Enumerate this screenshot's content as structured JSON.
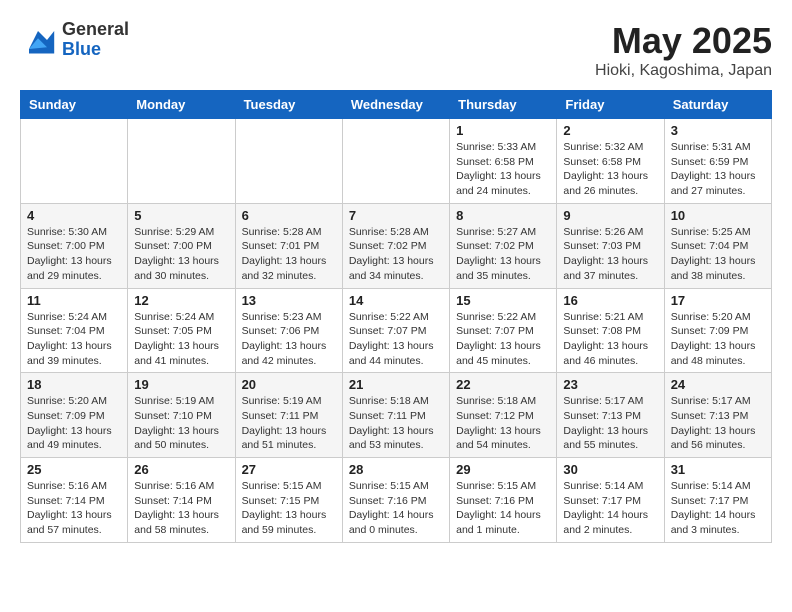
{
  "header": {
    "logo_general": "General",
    "logo_blue": "Blue",
    "month_year": "May 2025",
    "location": "Hioki, Kagoshima, Japan"
  },
  "weekdays": [
    "Sunday",
    "Monday",
    "Tuesday",
    "Wednesday",
    "Thursday",
    "Friday",
    "Saturday"
  ],
  "weeks": [
    [
      {
        "day": "",
        "info": ""
      },
      {
        "day": "",
        "info": ""
      },
      {
        "day": "",
        "info": ""
      },
      {
        "day": "",
        "info": ""
      },
      {
        "day": "1",
        "info": "Sunrise: 5:33 AM\nSunset: 6:58 PM\nDaylight: 13 hours\nand 24 minutes."
      },
      {
        "day": "2",
        "info": "Sunrise: 5:32 AM\nSunset: 6:58 PM\nDaylight: 13 hours\nand 26 minutes."
      },
      {
        "day": "3",
        "info": "Sunrise: 5:31 AM\nSunset: 6:59 PM\nDaylight: 13 hours\nand 27 minutes."
      }
    ],
    [
      {
        "day": "4",
        "info": "Sunrise: 5:30 AM\nSunset: 7:00 PM\nDaylight: 13 hours\nand 29 minutes."
      },
      {
        "day": "5",
        "info": "Sunrise: 5:29 AM\nSunset: 7:00 PM\nDaylight: 13 hours\nand 30 minutes."
      },
      {
        "day": "6",
        "info": "Sunrise: 5:28 AM\nSunset: 7:01 PM\nDaylight: 13 hours\nand 32 minutes."
      },
      {
        "day": "7",
        "info": "Sunrise: 5:28 AM\nSunset: 7:02 PM\nDaylight: 13 hours\nand 34 minutes."
      },
      {
        "day": "8",
        "info": "Sunrise: 5:27 AM\nSunset: 7:02 PM\nDaylight: 13 hours\nand 35 minutes."
      },
      {
        "day": "9",
        "info": "Sunrise: 5:26 AM\nSunset: 7:03 PM\nDaylight: 13 hours\nand 37 minutes."
      },
      {
        "day": "10",
        "info": "Sunrise: 5:25 AM\nSunset: 7:04 PM\nDaylight: 13 hours\nand 38 minutes."
      }
    ],
    [
      {
        "day": "11",
        "info": "Sunrise: 5:24 AM\nSunset: 7:04 PM\nDaylight: 13 hours\nand 39 minutes."
      },
      {
        "day": "12",
        "info": "Sunrise: 5:24 AM\nSunset: 7:05 PM\nDaylight: 13 hours\nand 41 minutes."
      },
      {
        "day": "13",
        "info": "Sunrise: 5:23 AM\nSunset: 7:06 PM\nDaylight: 13 hours\nand 42 minutes."
      },
      {
        "day": "14",
        "info": "Sunrise: 5:22 AM\nSunset: 7:07 PM\nDaylight: 13 hours\nand 44 minutes."
      },
      {
        "day": "15",
        "info": "Sunrise: 5:22 AM\nSunset: 7:07 PM\nDaylight: 13 hours\nand 45 minutes."
      },
      {
        "day": "16",
        "info": "Sunrise: 5:21 AM\nSunset: 7:08 PM\nDaylight: 13 hours\nand 46 minutes."
      },
      {
        "day": "17",
        "info": "Sunrise: 5:20 AM\nSunset: 7:09 PM\nDaylight: 13 hours\nand 48 minutes."
      }
    ],
    [
      {
        "day": "18",
        "info": "Sunrise: 5:20 AM\nSunset: 7:09 PM\nDaylight: 13 hours\nand 49 minutes."
      },
      {
        "day": "19",
        "info": "Sunrise: 5:19 AM\nSunset: 7:10 PM\nDaylight: 13 hours\nand 50 minutes."
      },
      {
        "day": "20",
        "info": "Sunrise: 5:19 AM\nSunset: 7:11 PM\nDaylight: 13 hours\nand 51 minutes."
      },
      {
        "day": "21",
        "info": "Sunrise: 5:18 AM\nSunset: 7:11 PM\nDaylight: 13 hours\nand 53 minutes."
      },
      {
        "day": "22",
        "info": "Sunrise: 5:18 AM\nSunset: 7:12 PM\nDaylight: 13 hours\nand 54 minutes."
      },
      {
        "day": "23",
        "info": "Sunrise: 5:17 AM\nSunset: 7:13 PM\nDaylight: 13 hours\nand 55 minutes."
      },
      {
        "day": "24",
        "info": "Sunrise: 5:17 AM\nSunset: 7:13 PM\nDaylight: 13 hours\nand 56 minutes."
      }
    ],
    [
      {
        "day": "25",
        "info": "Sunrise: 5:16 AM\nSunset: 7:14 PM\nDaylight: 13 hours\nand 57 minutes."
      },
      {
        "day": "26",
        "info": "Sunrise: 5:16 AM\nSunset: 7:14 PM\nDaylight: 13 hours\nand 58 minutes."
      },
      {
        "day": "27",
        "info": "Sunrise: 5:15 AM\nSunset: 7:15 PM\nDaylight: 13 hours\nand 59 minutes."
      },
      {
        "day": "28",
        "info": "Sunrise: 5:15 AM\nSunset: 7:16 PM\nDaylight: 14 hours\nand 0 minutes."
      },
      {
        "day": "29",
        "info": "Sunrise: 5:15 AM\nSunset: 7:16 PM\nDaylight: 14 hours\nand 1 minute."
      },
      {
        "day": "30",
        "info": "Sunrise: 5:14 AM\nSunset: 7:17 PM\nDaylight: 14 hours\nand 2 minutes."
      },
      {
        "day": "31",
        "info": "Sunrise: 5:14 AM\nSunset: 7:17 PM\nDaylight: 14 hours\nand 3 minutes."
      }
    ]
  ]
}
